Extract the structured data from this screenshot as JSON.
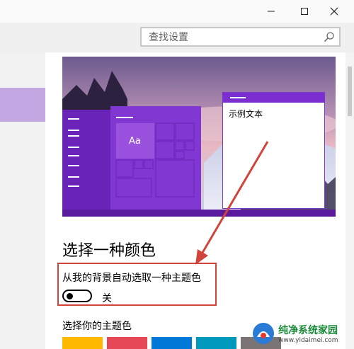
{
  "window": {
    "minimize_icon": "minimize-icon",
    "maximize_icon": "maximize-icon",
    "close_icon": "close-icon"
  },
  "search": {
    "placeholder": "查找设置",
    "icon": "search-icon"
  },
  "preview": {
    "sample_text": "示例文本",
    "tile_label": "Aa",
    "accent_color": "#7b2fd0"
  },
  "colors_section": {
    "title": "选择一种颜色",
    "auto_pick_label": "从我的背景自动选取一种主题色",
    "toggle_state": "关",
    "accent_title": "选择你的主题色",
    "swatches": [
      "#ffb900",
      "#e74856",
      "#0078d7",
      "#0099bc",
      "#7a7574"
    ]
  },
  "annotation": {
    "highlight_color": "#d0443c"
  },
  "watermark": {
    "text": "纯净系统家园",
    "url": "www.yidaimei.com"
  }
}
